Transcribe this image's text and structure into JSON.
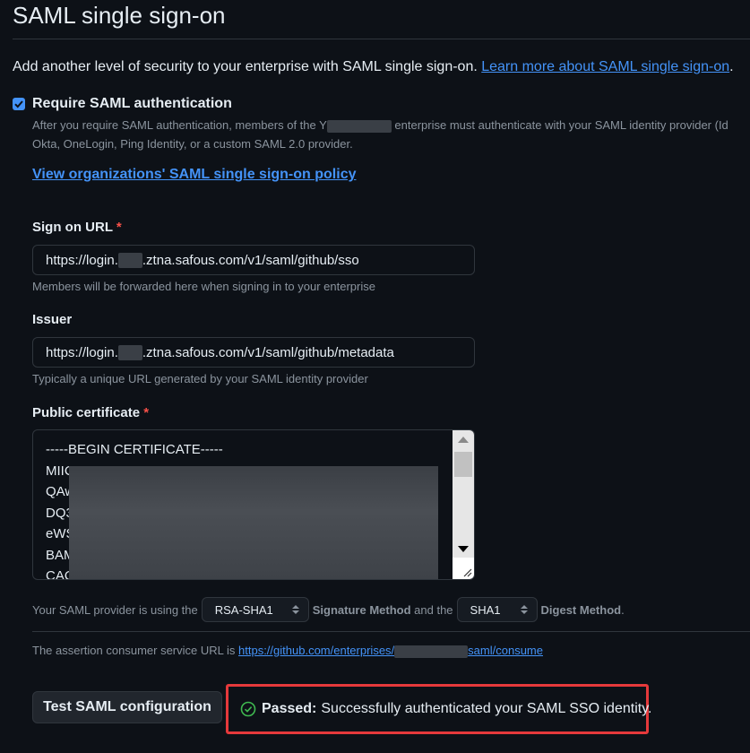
{
  "page": {
    "title": "SAML single sign-on",
    "intro_text": "Add another level of security to your enterprise with SAML single sign-on.",
    "intro_link": "Learn more about SAML single sign-on",
    "intro_end": "."
  },
  "require_saml": {
    "checked": true,
    "label": "Require SAML authentication",
    "desc_part1": "After you require SAML authentication, members of the Y",
    "desc_part2": "enterprise must authenticate with your SAML identity provider (Id",
    "desc_line2": "Okta, OneLogin, Ping Identity, or a custom SAML 2.0 provider."
  },
  "policy_link": "View organizations' SAML single sign-on policy",
  "sign_on_url": {
    "label": "Sign on URL",
    "required_mark": "*",
    "value_prefix": "https://login.",
    "value_suffix": ".ztna.safous.com/v1/saml/github/sso",
    "help": "Members will be forwarded here when signing in to your enterprise"
  },
  "issuer": {
    "label": "Issuer",
    "value_prefix": "https://login.",
    "value_suffix": ".ztna.safous.com/v1/saml/github/metadata",
    "help": "Typically a unique URL generated by your SAML identity provider"
  },
  "public_certificate": {
    "label": "Public certificate",
    "required_mark": "*",
    "lines": [
      "-----BEGIN CERTIFICATE-----",
      "MIIC",
      "QAw",
      "DQ3",
      "eWS",
      "BAM",
      "CAQ"
    ]
  },
  "signature": {
    "text1": "Your SAML provider is using the",
    "signature_method_value": "RSA-SHA1",
    "text2": "Signature Method",
    "text3": "and the",
    "digest_method_value": "SHA1",
    "text4": "Digest Method",
    "text5": "."
  },
  "acs": {
    "text": "The assertion consumer service URL is",
    "url_prefix": "https://github.com/enterprises/",
    "url_suffix": "saml/consume"
  },
  "test_button": "Test SAML configuration",
  "result": {
    "status": "Passed:",
    "message": "Successfully authenticated your SAML SSO identity."
  },
  "colors": {
    "accent": "#4493f8",
    "success": "#3fb950",
    "required": "#f85149",
    "highlight_border": "#e5393b"
  }
}
